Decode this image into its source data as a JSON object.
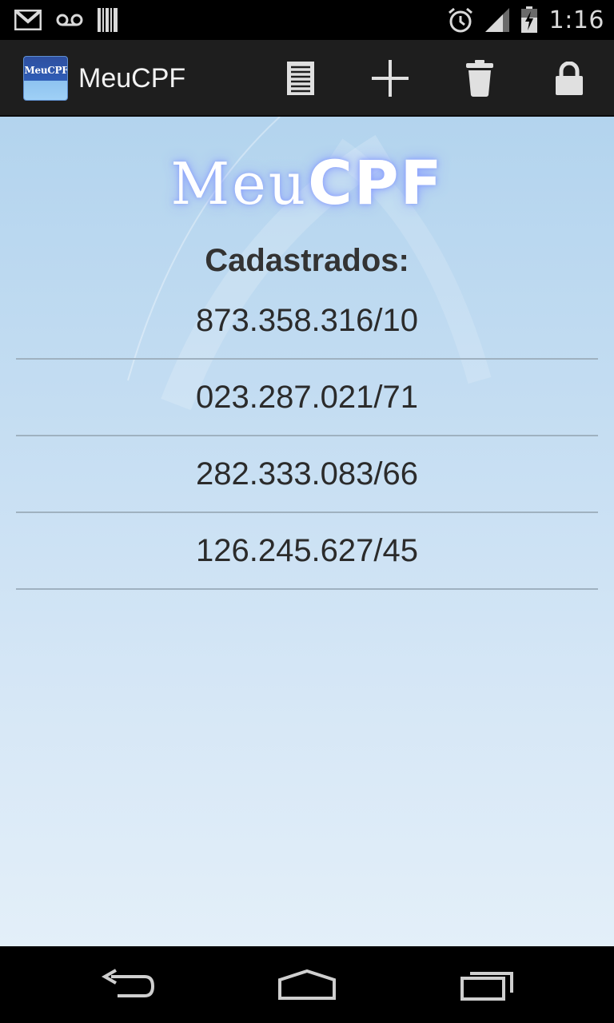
{
  "status_bar": {
    "time": "1:16",
    "icons": [
      "gmail-icon",
      "voicemail-icon",
      "barcode-icon",
      "alarm-icon",
      "signal-icon",
      "battery-charging-icon"
    ]
  },
  "action_bar": {
    "app_icon_text": "MeuCPF",
    "title": "MeuCPF",
    "actions": [
      "list-icon",
      "add-icon",
      "trash-icon",
      "lock-icon"
    ]
  },
  "content": {
    "logo": {
      "meu": "Meu",
      "cpf": "CPF"
    },
    "heading": "Cadastrados:",
    "items": [
      {
        "value": "873.358.316/10"
      },
      {
        "value": "023.287.021/71"
      },
      {
        "value": "282.333.083/66"
      },
      {
        "value": "126.245.627/45"
      }
    ]
  },
  "nav_bar": {
    "buttons": [
      "back-icon",
      "home-icon",
      "recent-apps-icon"
    ]
  },
  "colors": {
    "status_bar_bg": "#000000",
    "action_bar_bg": "#1e1e1e",
    "content_bg_top": "#b3d4ee",
    "content_bg_bottom": "#e3eff9",
    "divider": "#9fb1c0",
    "text": "#2b2b2b"
  }
}
